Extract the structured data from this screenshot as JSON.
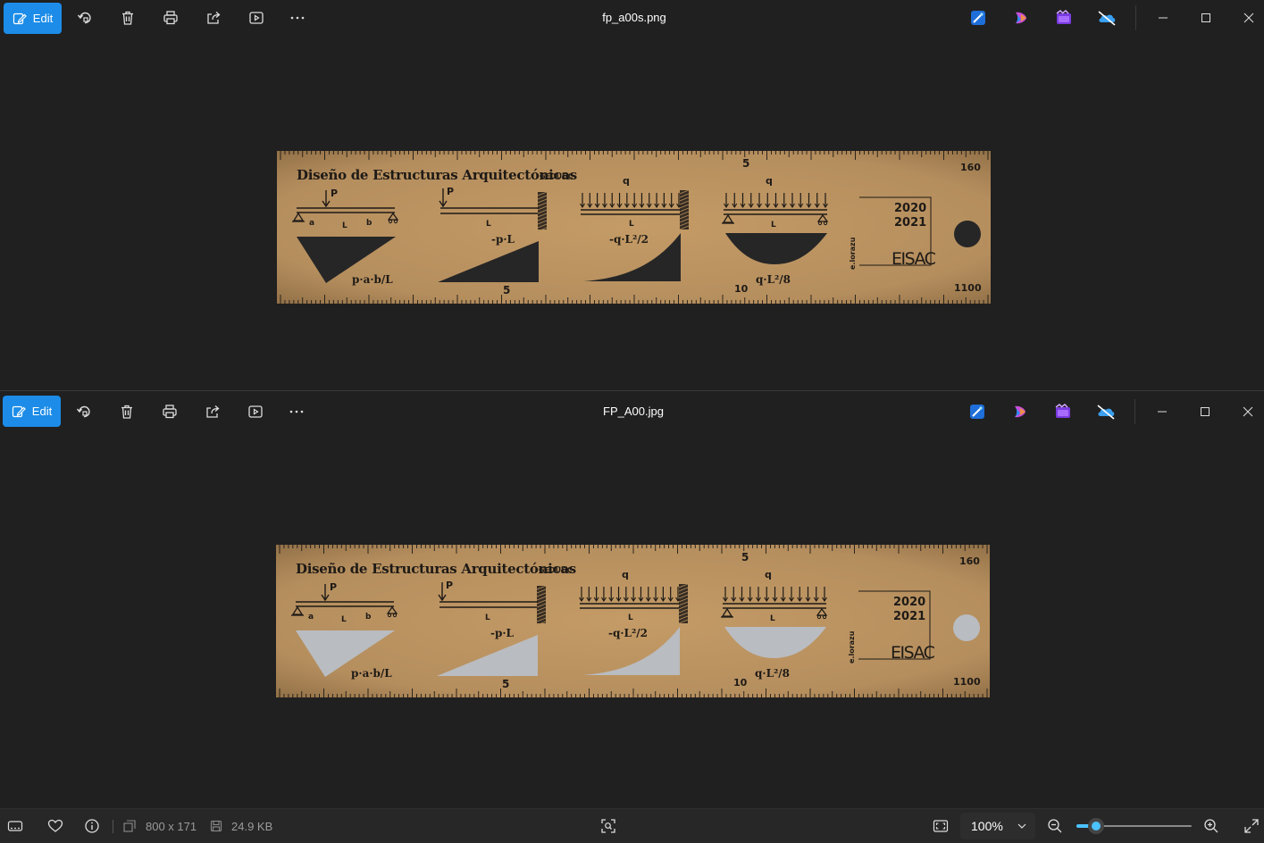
{
  "windows": [
    {
      "id": "top",
      "edit_label": "Edit",
      "filename": "fp_a00s.png",
      "cutout_color": "#262626"
    },
    {
      "id": "bottom",
      "edit_label": "Edit",
      "filename": "FP_A00.jpg",
      "cutout_color": "#b9bcc0"
    }
  ],
  "toolbar_icons": [
    "edit-icon",
    "rotate-icon",
    "delete-icon",
    "print-icon",
    "share-icon",
    "slideshow-icon",
    "more-icon"
  ],
  "app_icons": [
    "photo-editor-icon",
    "copilot-icon",
    "clipchamp-icon",
    "onedrive-off-icon"
  ],
  "ruler": {
    "title": "Diseño de Estructuras Arquitectónicas",
    "dept": "GEDUGC",
    "year_top": "2020",
    "year_bottom": "2021",
    "school": "EISAC",
    "author": "e.lorazu",
    "mark_160": "160",
    "mark_1100": "1100",
    "mark_5_top": "5",
    "mark_5_bottom": "5",
    "mark_10": "10",
    "load_p1": "P",
    "load_p2": "P",
    "load_q1": "q",
    "load_q2": "q",
    "dim_a": "a",
    "dim_L1": "L",
    "dim_b": "b",
    "dim_L2": "L",
    "dim_L3": "L",
    "dim_L4": "L",
    "formula_1": "p·a·b/L",
    "formula_2": "-p·L",
    "formula_3": "-q·L²/2",
    "formula_4": "q·L²/8",
    "wood_color": "#b58e5e",
    "ink_color": "#1e1a16"
  },
  "status": {
    "dimensions": "800 x 171",
    "filesize": "24.9 KB",
    "zoom": "100%",
    "zoom_fraction": 0.17
  }
}
